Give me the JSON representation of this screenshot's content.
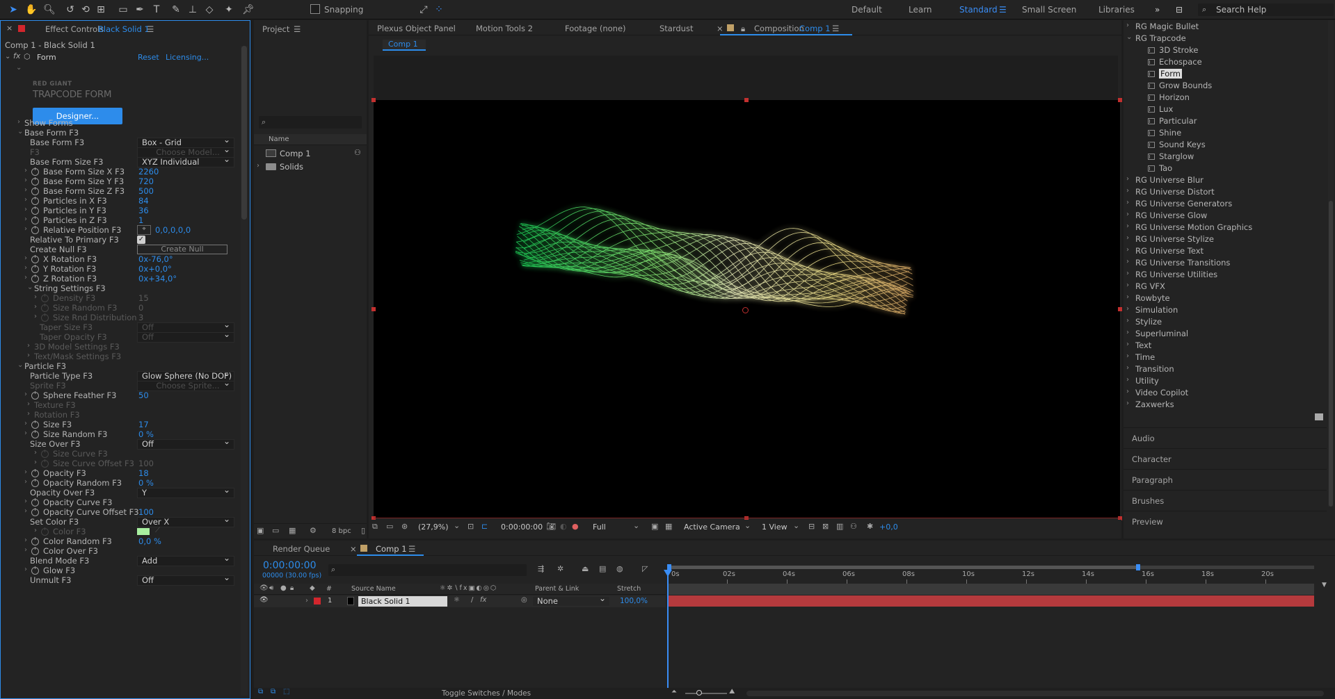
{
  "toolbar": {
    "snapping_label": "Snapping",
    "workspaces": [
      "Default",
      "Learn",
      "Standard",
      "Small Screen",
      "Libraries"
    ],
    "search_placeholder": "Search Help"
  },
  "effect_controls": {
    "tab_title": "Effect Controls",
    "tab_layer": "Black Solid 1",
    "subtitle": "Comp 1 - Black Solid 1",
    "effect_name": "Form",
    "reset": "Reset",
    "licensing": "Licensing...",
    "brand_top": "RED GIANT",
    "brand_name": "TRAPCODE FORM",
    "designer_btn": "Designer...",
    "properties": {
      "show_forms": "Show Forms",
      "base_form_group": "Base Form F3",
      "base_form": "Base Form F3",
      "base_form_val": "Box - Grid",
      "f3": "F3",
      "choose_model": "Choose Model...",
      "base_form_size": "Base Form Size F3",
      "base_form_size_val": "XYZ Individual",
      "size_x": "Base Form Size X F3",
      "size_x_val": "2260",
      "size_y": "Base Form Size Y F3",
      "size_y_val": "720",
      "size_z": "Base Form Size Z F3",
      "size_z_val": "500",
      "px": "Particles in X F3",
      "px_val": "84",
      "py": "Particles in Y F3",
      "py_val": "36",
      "pz": "Particles in Z F3",
      "pz_val": "1",
      "relpos": "Relative Position F3",
      "relpos_val": "0,0,0,0,0",
      "reltoprimary": "Relative To Primary F3",
      "create_null": "Create Null F3",
      "create_null_btn": "Create Null",
      "xrot": "X Rotation F3",
      "xrot_val": "0x-76,0°",
      "yrot": "Y Rotation F3",
      "yrot_val": "0x+0,0°",
      "zrot": "Z Rotation F3",
      "zrot_val": "0x+34,0°",
      "string_settings": "String Settings F3",
      "density": "Density F3",
      "density_val": "15",
      "size_random_s": "Size Random F3",
      "size_random_s_val": "0",
      "size_rnd_dist": "Size Rnd Distribution",
      "size_rnd_dist_val": "3",
      "taper_size": "Taper Size F3",
      "taper_size_val": "Off",
      "taper_opacity": "Taper Opacity F3",
      "taper_opacity_val": "Off",
      "model3d": "3D Model Settings F3",
      "textmask": "Text/Mask Settings F3",
      "particle_group": "Particle F3",
      "particle_type": "Particle Type F3",
      "particle_type_val": "Glow Sphere (No DOF)",
      "sprite": "Sprite F3",
      "choose_sprite": "Choose Sprite...",
      "sphere_feather": "Sphere Feather F3",
      "sphere_feather_val": "50",
      "texture": "Texture F3",
      "rotation": "Rotation F3",
      "size": "Size F3",
      "size_val": "17",
      "size_random": "Size Random F3",
      "size_random_val": "0 %",
      "size_over": "Size Over F3",
      "size_over_val": "Off",
      "size_curve": "Size Curve F3",
      "size_curve_offset": "Size Curve Offset F3",
      "size_curve_offset_val": "100",
      "opacity": "Opacity F3",
      "opacity_val": "18",
      "opacity_random": "Opacity Random F3",
      "opacity_random_val": "0 %",
      "opacity_over": "Opacity Over F3",
      "opacity_over_val": "Y",
      "opacity_curve": "Opacity Curve F3",
      "opacity_curve_offset": "Opacity Curve Offset F3",
      "opacity_curve_offset_val": "100",
      "set_color": "Set Color F3",
      "set_color_val": "Over X",
      "color": "Color F3",
      "color_random": "Color Random F3",
      "color_random_val": "0,0 %",
      "color_over": "Color Over F3",
      "blend_mode": "Blend Mode F3",
      "blend_mode_val": "Add",
      "glow": "Glow F3",
      "unmult": "Unmult F3",
      "unmult_val": "Off"
    },
    "swatch_color": "#a8f0a0"
  },
  "project": {
    "tab": "Project",
    "search_placeholder": "",
    "col_name": "Name",
    "items": [
      "Comp 1",
      "Solids"
    ],
    "bpc": "8 bpc"
  },
  "viewer": {
    "tabs": [
      "Plexus Object Panel",
      "Motion Tools 2",
      "Footage (none)",
      "Stardust"
    ],
    "comp_tab_prefix": "Composition",
    "comp_tab_name": "Comp 1",
    "breadcrumb": "Comp 1",
    "zoom": "(27,9%)",
    "timecode": "0:00:00:00",
    "resolution": "Full",
    "camera": "Active Camera",
    "view": "1 View",
    "exposure": "+0,0"
  },
  "effects_panel": {
    "rg_magic_bullet": "RG Magic Bullet",
    "rg_trapcode": "RG Trapcode",
    "trapcode_items": [
      "3D Stroke",
      "Echospace",
      "Form",
      "Grow Bounds",
      "Horizon",
      "Lux",
      "Particular",
      "Shine",
      "Sound Keys",
      "Starglow",
      "Tao"
    ],
    "selected": "Form",
    "categories": [
      "RG Universe Blur",
      "RG Universe Distort",
      "RG Universe Generators",
      "RG Universe Glow",
      "RG Universe Motion Graphics",
      "RG Universe Stylize",
      "RG Universe Text",
      "RG Universe Transitions",
      "RG Universe Utilities",
      "RG VFX",
      "Rowbyte",
      "Simulation",
      "Stylize",
      "Superluminal",
      "Text",
      "Time",
      "Transition",
      "Utility",
      "Video Copilot",
      "Zaxwerks"
    ],
    "collapsed_panels": [
      "Audio",
      "Character",
      "Paragraph",
      "Brushes",
      "Preview"
    ]
  },
  "timeline": {
    "render_queue": "Render Queue",
    "comp_tab": "Comp 1",
    "timecode": "0:00:00:00",
    "frame_info": "00000 (30.00 fps)",
    "col_hash": "#",
    "col_source": "Source Name",
    "col_parent": "Parent & Link",
    "col_stretch": "Stretch",
    "layer_num": "1",
    "layer_name": "Black Solid 1",
    "parent_val": "None",
    "stretch_val": "100,0%",
    "ruler": [
      "0s",
      "02s",
      "04s",
      "06s",
      "08s",
      "10s",
      "12s",
      "14s",
      "16s",
      "18s",
      "20s"
    ],
    "toggle_label": "Toggle Switches / Modes"
  },
  "colors": {
    "accent": "#2d8ceb",
    "layer_bar": "#b53a3d",
    "playhead": "#3a8df5"
  }
}
